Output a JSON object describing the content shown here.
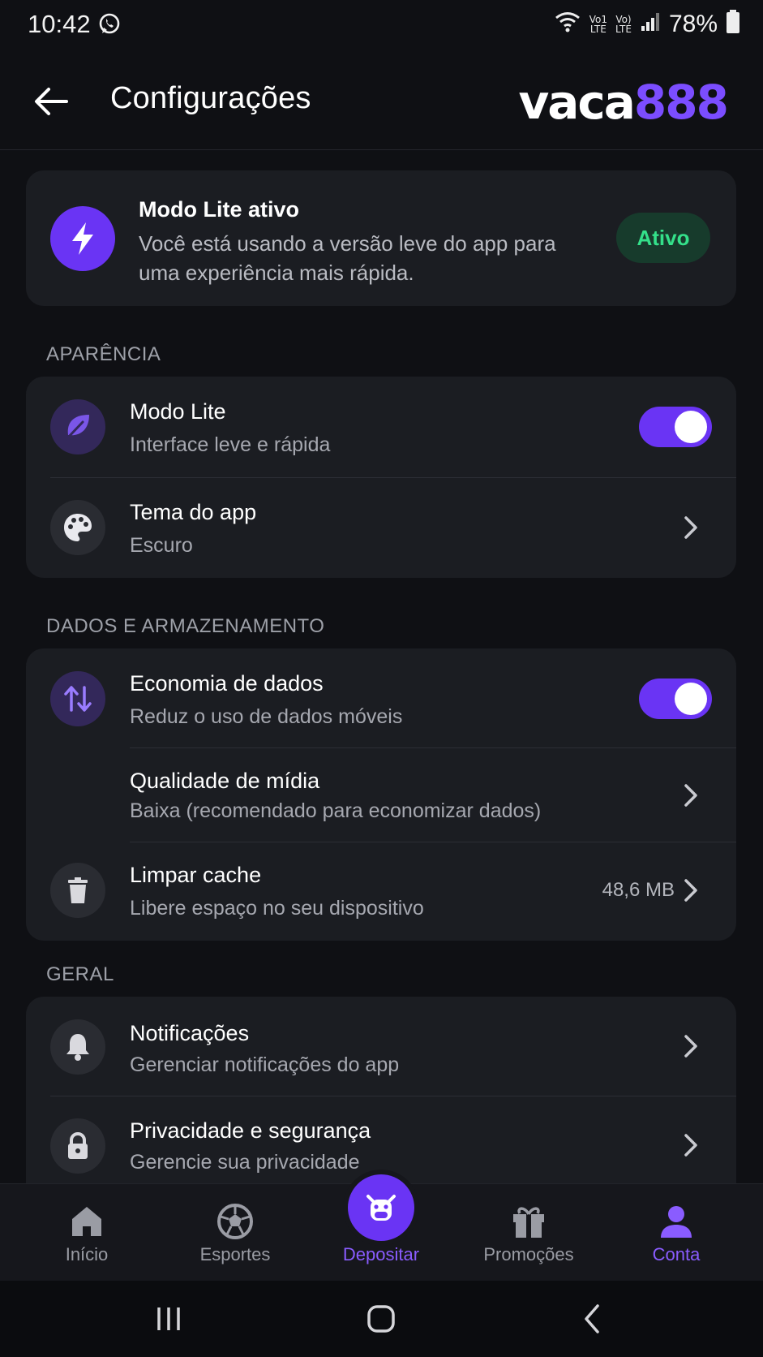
{
  "status_bar": {
    "time": "10:42",
    "battery_percent": "78%",
    "volte_top": "Vo)",
    "volte_bottom": "LTE",
    "lte1_top": "Vo1",
    "lte1_bottom": "LTE"
  },
  "header": {
    "title": "Configurações",
    "brand_word": "vaca",
    "brand_number": "888"
  },
  "lite_banner": {
    "title": "Modo Lite ativo",
    "description": "Você está usando a versão leve do app para uma experiência mais rápida.",
    "badge": "Ativo"
  },
  "sections": {
    "appearance": {
      "label": "APARÊNCIA",
      "lite_mode": {
        "title": "Modo Lite",
        "subtitle": "Interface leve e rápida",
        "enabled": true
      },
      "theme": {
        "title": "Tema do app",
        "subtitle": "Escuro"
      }
    },
    "data": {
      "label": "DADOS E ARMAZENAMENTO",
      "data_saver": {
        "title": "Economia de dados",
        "subtitle": "Reduz o uso de dados móveis",
        "enabled": true
      },
      "media_quality": {
        "title": "Qualidade de mídia",
        "subtitle": "Baixa (recomendado para economizar dados)"
      },
      "clear_cache": {
        "title": "Limpar cache",
        "subtitle": "Libere espaço no seu dispositivo",
        "value": "48,6 MB"
      }
    },
    "general": {
      "label": "GERAL",
      "notifications": {
        "title": "Notificações",
        "subtitle": "Gerenciar notificações do app"
      },
      "privacy": {
        "title": "Privacidade e segurança",
        "subtitle": "Gerencie sua privacidade"
      }
    }
  },
  "bottom_nav": {
    "home": "Início",
    "sports": "Esportes",
    "deposit": "Depositar",
    "promotions": "Promoções",
    "account": "Conta"
  },
  "colors": {
    "accent": "#6a34f4",
    "active_label": "#8a5cff",
    "badge_text": "#34e08a",
    "background": "#0f1014",
    "card": "#1b1d22"
  },
  "icons": {
    "lite_banner": "lightning-bolt-icon",
    "lite_mode": "leaf-icon",
    "theme": "palette-icon",
    "data_saver": "arrows-up-down-icon",
    "clear_cache": "trash-icon",
    "notifications": "bell-icon",
    "privacy": "lock-icon"
  }
}
